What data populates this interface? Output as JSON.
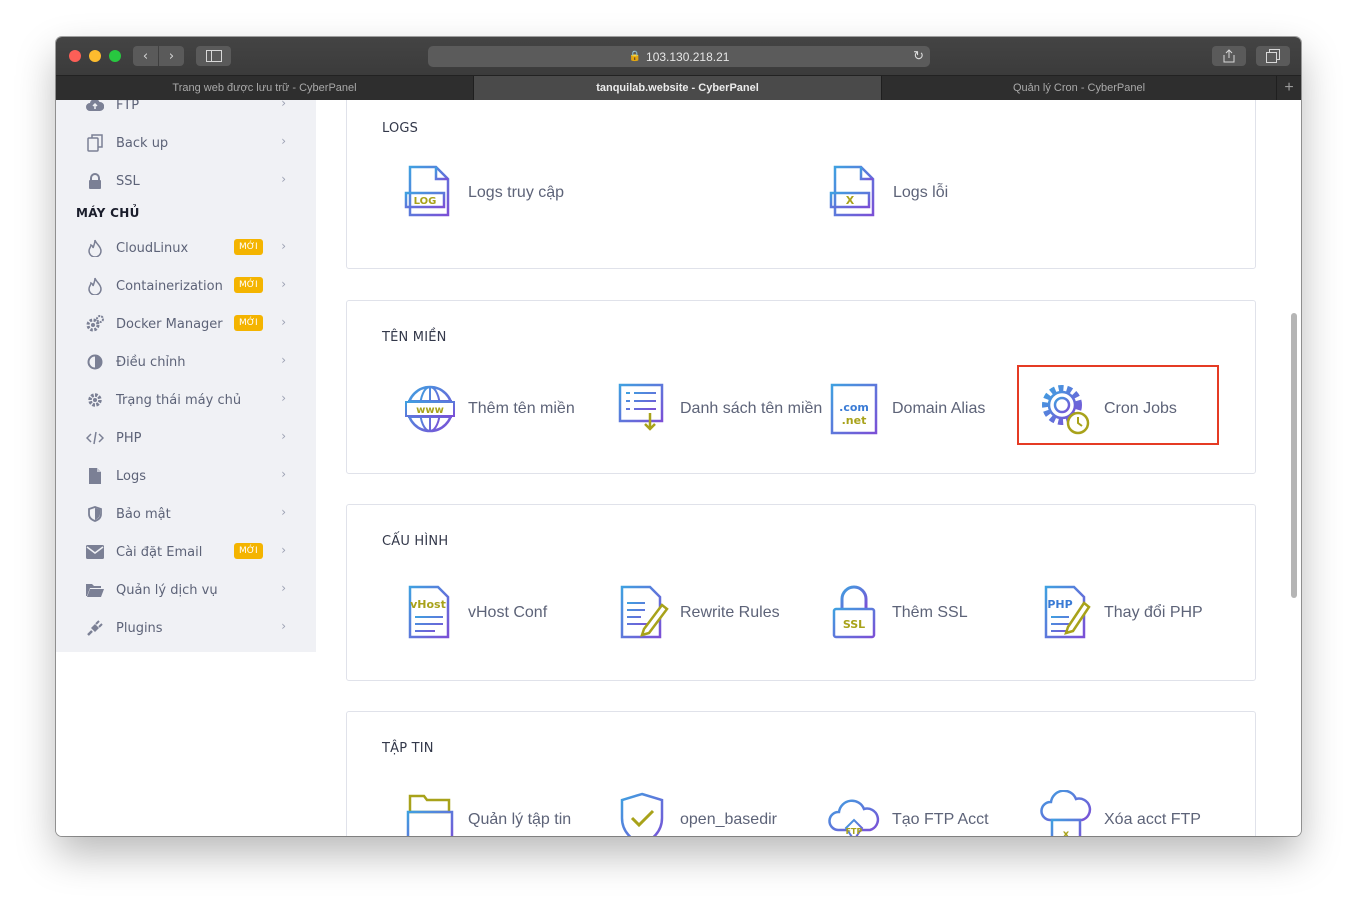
{
  "browser": {
    "url": "103.130.218.21",
    "tabs": [
      {
        "title": "Trang web được lưu trữ - CyberPanel",
        "active": false
      },
      {
        "title": "tanquilab.website - CyberPanel",
        "active": true
      },
      {
        "title": "Quản lý Cron - CyberPanel",
        "active": false
      }
    ],
    "new_tab": "+"
  },
  "sidebar": {
    "heading": "MÁY CHỦ",
    "badge_label": "MỚI",
    "badge_color": "#f4b400",
    "items": [
      {
        "label": "FTP",
        "icon": "cloud-upload-icon"
      },
      {
        "label": "Back up",
        "icon": "copy-icon"
      },
      {
        "label": "SSL",
        "icon": "lock-icon"
      },
      {
        "label": "CloudLinux",
        "icon": "fire-icon",
        "badge": true
      },
      {
        "label": "Containerization",
        "icon": "fire-icon",
        "badge": true
      },
      {
        "label": "Docker Manager",
        "icon": "cogs-icon",
        "badge": true
      },
      {
        "label": "Điều chỉnh",
        "icon": "half-circle-icon"
      },
      {
        "label": "Trạng thái máy chủ",
        "icon": "gear-icon"
      },
      {
        "label": "PHP",
        "icon": "code-icon"
      },
      {
        "label": "Logs",
        "icon": "file-icon"
      },
      {
        "label": "Bảo mật",
        "icon": "shield-icon"
      },
      {
        "label": "Cài đặt Email",
        "icon": "envelope-icon",
        "badge": true
      },
      {
        "label": "Quản lý dịch vụ",
        "icon": "folder-open-icon"
      },
      {
        "label": "Plugins",
        "icon": "plug-icon"
      }
    ]
  },
  "sections": {
    "logs": {
      "title": "LOGS",
      "items": [
        {
          "label": "Logs truy cập",
          "icon": "access-log-icon"
        },
        {
          "label": "Logs lỗi",
          "icon": "error-log-icon"
        }
      ]
    },
    "domains": {
      "title": "TÊN MIỀN",
      "items": [
        {
          "label": "Thêm tên miền",
          "icon": "www-globe-icon"
        },
        {
          "label": "Danh sách tên miền",
          "icon": "list-download-icon"
        },
        {
          "label": "Domain Alias",
          "icon": "com-net-icon"
        },
        {
          "label": "Cron Jobs",
          "icon": "gear-clock-icon"
        }
      ]
    },
    "config": {
      "title": "CẤU HÌNH",
      "items": [
        {
          "label": "vHost Conf",
          "icon": "vhost-icon"
        },
        {
          "label": "Rewrite Rules",
          "icon": "edit-document-icon"
        },
        {
          "label": "Thêm SSL",
          "icon": "ssl-lock-icon"
        },
        {
          "label": "Thay đổi PHP",
          "icon": "php-edit-icon"
        }
      ]
    },
    "files": {
      "title": "TẬP TIN",
      "items": [
        {
          "label": "Quản lý tập tin",
          "icon": "file-cabinet-icon"
        },
        {
          "label": "open_basedir",
          "icon": "shield-check-icon"
        },
        {
          "label": "Tạo FTP Acct",
          "icon": "ftp-cloud-icon"
        },
        {
          "label": "Xóa acct FTP",
          "icon": "ftp-delete-icon"
        }
      ]
    }
  },
  "colors": {
    "icon_blue": "#3a7bd5",
    "icon_purple": "#7b4fd6",
    "icon_olive": "#a8a21a",
    "highlight_red": "#e53b24"
  }
}
